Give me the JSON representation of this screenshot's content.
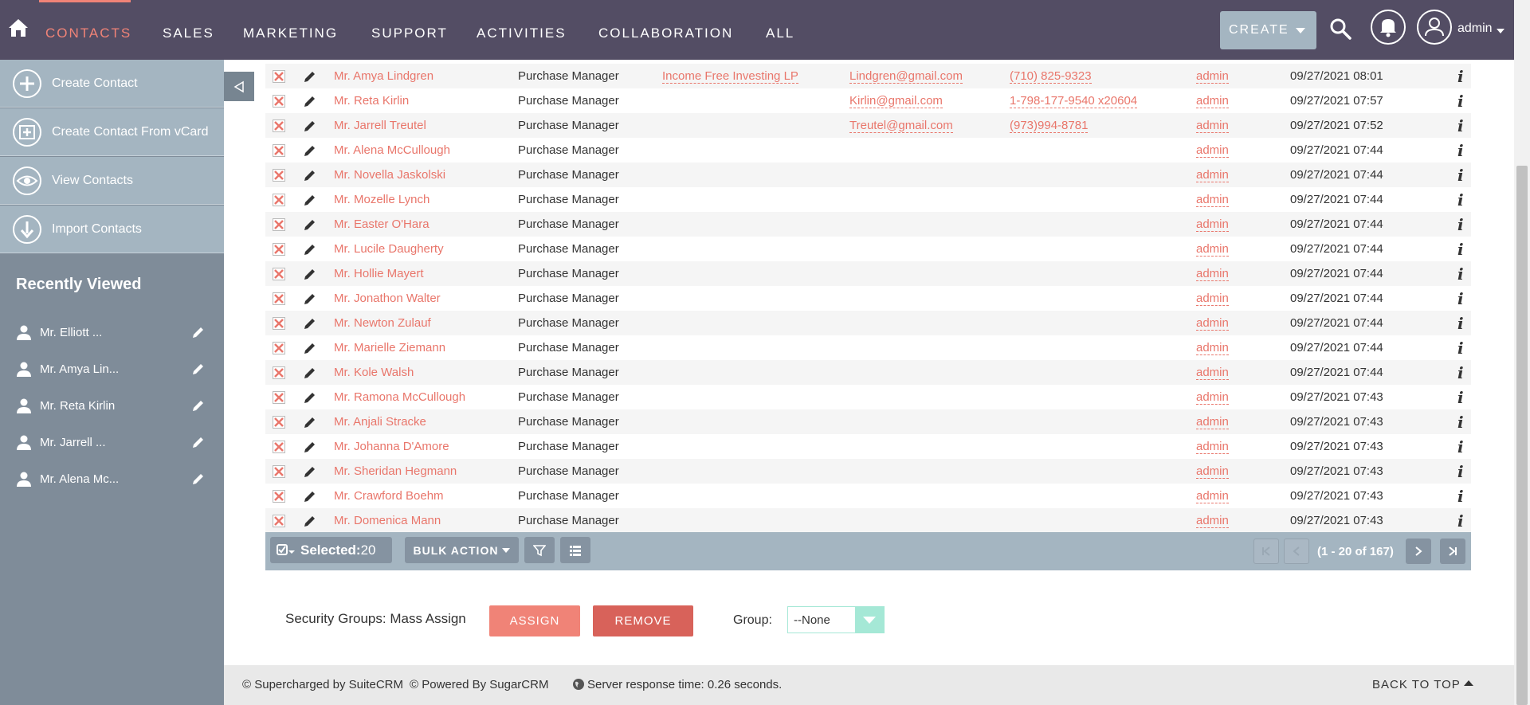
{
  "nav": {
    "items": [
      "Contacts",
      "Sales",
      "Marketing",
      "Support",
      "Activities",
      "Collaboration",
      "All"
    ],
    "active": "Contacts",
    "create_label": "CREATE",
    "user_label": "admin",
    "accent_color": "#f08377",
    "bg_color": "#534d64"
  },
  "sidebar": {
    "actions": [
      {
        "label": "Create Contact",
        "icon": "plus-circle-icon"
      },
      {
        "label": "Create Contact From vCard",
        "icon": "vcard-icon"
      },
      {
        "label": "View Contacts",
        "icon": "eye-icon"
      },
      {
        "label": "Import Contacts",
        "icon": "download-icon"
      }
    ],
    "recent_title": "Recently Viewed",
    "recent": [
      "Mr. Elliott ...",
      "Mr. Amya Lin...",
      "Mr. Reta Kirlin",
      "Mr. Jarrell ...",
      "Mr. Alena Mc..."
    ]
  },
  "table": {
    "rows": [
      {
        "name": "Mr. Amya Lindgren",
        "title": "Purchase Manager",
        "account": "Income Free Investing LP",
        "email": "Lindgren@gmail.com",
        "phone": "(710) 825-9323",
        "user": "admin",
        "date": "09/27/2021 08:01"
      },
      {
        "name": "Mr. Reta Kirlin",
        "title": "Purchase Manager",
        "account": "",
        "email": "Kirlin@gmail.com",
        "phone": "1-798-177-9540 x20604",
        "user": "admin",
        "date": "09/27/2021 07:57"
      },
      {
        "name": "Mr. Jarrell Treutel",
        "title": "Purchase Manager",
        "account": "",
        "email": "Treutel@gmail.com",
        "phone": "(973)994-8781",
        "user": "admin",
        "date": "09/27/2021 07:52"
      },
      {
        "name": "Mr. Alena McCullough",
        "title": "Purchase Manager",
        "account": "",
        "email": "",
        "phone": "",
        "user": "admin",
        "date": "09/27/2021 07:44"
      },
      {
        "name": "Mr. Novella Jaskolski",
        "title": "Purchase Manager",
        "account": "",
        "email": "",
        "phone": "",
        "user": "admin",
        "date": "09/27/2021 07:44"
      },
      {
        "name": "Mr. Mozelle Lynch",
        "title": "Purchase Manager",
        "account": "",
        "email": "",
        "phone": "",
        "user": "admin",
        "date": "09/27/2021 07:44"
      },
      {
        "name": "Mr. Easter O'Hara",
        "title": "Purchase Manager",
        "account": "",
        "email": "",
        "phone": "",
        "user": "admin",
        "date": "09/27/2021 07:44"
      },
      {
        "name": "Mr. Lucile Daugherty",
        "title": "Purchase Manager",
        "account": "",
        "email": "",
        "phone": "",
        "user": "admin",
        "date": "09/27/2021 07:44"
      },
      {
        "name": "Mr. Hollie Mayert",
        "title": "Purchase Manager",
        "account": "",
        "email": "",
        "phone": "",
        "user": "admin",
        "date": "09/27/2021 07:44"
      },
      {
        "name": "Mr. Jonathon Walter",
        "title": "Purchase Manager",
        "account": "",
        "email": "",
        "phone": "",
        "user": "admin",
        "date": "09/27/2021 07:44"
      },
      {
        "name": "Mr. Newton Zulauf",
        "title": "Purchase Manager",
        "account": "",
        "email": "",
        "phone": "",
        "user": "admin",
        "date": "09/27/2021 07:44"
      },
      {
        "name": "Mr. Marielle Ziemann",
        "title": "Purchase Manager",
        "account": "",
        "email": "",
        "phone": "",
        "user": "admin",
        "date": "09/27/2021 07:44"
      },
      {
        "name": "Mr. Kole Walsh",
        "title": "Purchase Manager",
        "account": "",
        "email": "",
        "phone": "",
        "user": "admin",
        "date": "09/27/2021 07:44"
      },
      {
        "name": "Mr. Ramona McCullough",
        "title": "Purchase Manager",
        "account": "",
        "email": "",
        "phone": "",
        "user": "admin",
        "date": "09/27/2021 07:43"
      },
      {
        "name": "Mr. Anjali Stracke",
        "title": "Purchase Manager",
        "account": "",
        "email": "",
        "phone": "",
        "user": "admin",
        "date": "09/27/2021 07:43"
      },
      {
        "name": "Mr. Johanna D'Amore",
        "title": "Purchase Manager",
        "account": "",
        "email": "",
        "phone": "",
        "user": "admin",
        "date": "09/27/2021 07:43"
      },
      {
        "name": "Mr. Sheridan Hegmann",
        "title": "Purchase Manager",
        "account": "",
        "email": "",
        "phone": "",
        "user": "admin",
        "date": "09/27/2021 07:43"
      },
      {
        "name": "Mr. Crawford Boehm",
        "title": "Purchase Manager",
        "account": "",
        "email": "",
        "phone": "",
        "user": "admin",
        "date": "09/27/2021 07:43"
      },
      {
        "name": "Mr. Domenica Mann",
        "title": "Purchase Manager",
        "account": "",
        "email": "",
        "phone": "",
        "user": "admin",
        "date": "09/27/2021 07:43"
      }
    ],
    "info_glyph": "i"
  },
  "toolbar": {
    "selected_label": "Selected:",
    "selected_count": "20",
    "bulk_label": "BULK ACTION",
    "pagination": "(1 - 20 of 167)"
  },
  "mass_assign": {
    "label": "Security Groups: Mass Assign",
    "assign": "ASSIGN",
    "remove": "REMOVE",
    "group_label": "Group:",
    "group_value": "--None"
  },
  "footer": {
    "suitecrm": "© Supercharged by SuiteCRM",
    "sugarcrm": "© Powered By SugarCRM",
    "response": "Server response time: 0.26 seconds.",
    "back_to_top": "BACK TO TOP"
  }
}
